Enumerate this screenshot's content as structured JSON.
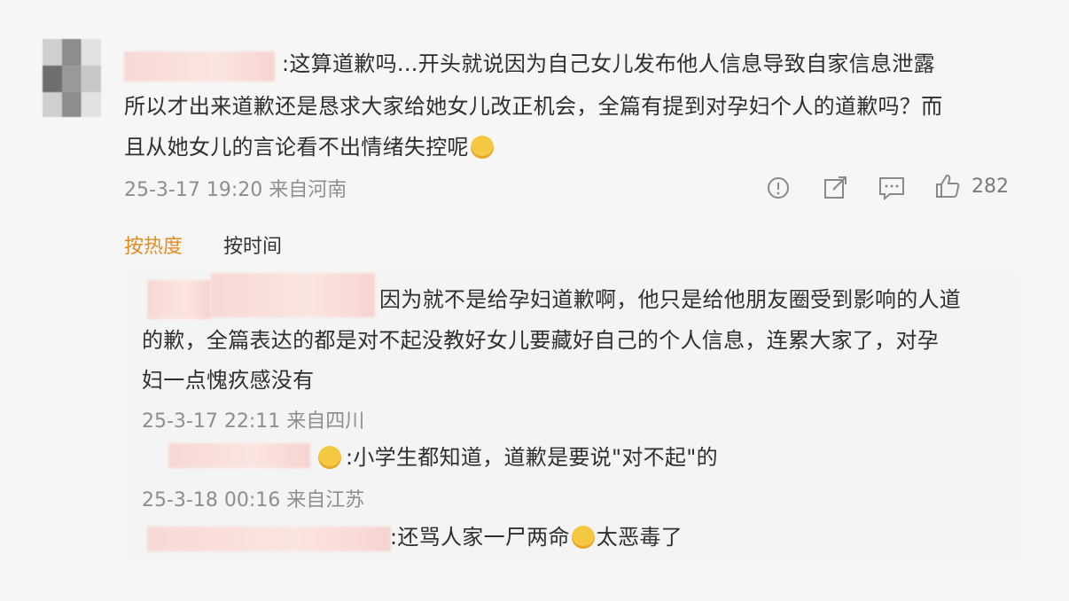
{
  "comment": {
    "text": ":这算道歉吗...开头就说因为自己女儿发布他人信息导致自家信息泄露所以才出来道歉还是恳求大家给她女儿改正机会，全篇有提到对孕妇个人的道歉吗？而且从她女儿的言论看不出情绪失控呢",
    "line1": ":这算道歉吗...开头就说因为自己女儿发布他人信息导致自家信息泄露",
    "line2": "所以才出来道歉还是恳求大家给她女儿改正机会，全篇有提到对孕妇个人的道歉吗？而",
    "line3": "且从她女儿的言论看不出情绪失控呢",
    "timestamp": "25-3-17 19:20 来自河南",
    "like_count": "282"
  },
  "sort_tabs": {
    "hot": "按热度",
    "time": "按时间"
  },
  "replies": [
    {
      "line1": "因为就不是给孕妇道歉啊，他只是给他朋友圈受到影响的人道",
      "line2": "的歉，全篇表达的都是对不起没教好女儿要藏好自己的个人信息，连累大家了，对孕",
      "line3": "妇一点愧疚感没有",
      "timestamp": "25-3-17 22:11 来自四川"
    },
    {
      "line1": ":小学生都知道，道歉是要说\"对不起\"的",
      "timestamp": "25-3-18 00:16 来自江苏"
    },
    {
      "line1": ":还骂人家一尸两命",
      "line1b": "太恶毒了"
    }
  ],
  "icons": [
    "info-icon",
    "share-icon",
    "comment-icon",
    "like-icon"
  ]
}
